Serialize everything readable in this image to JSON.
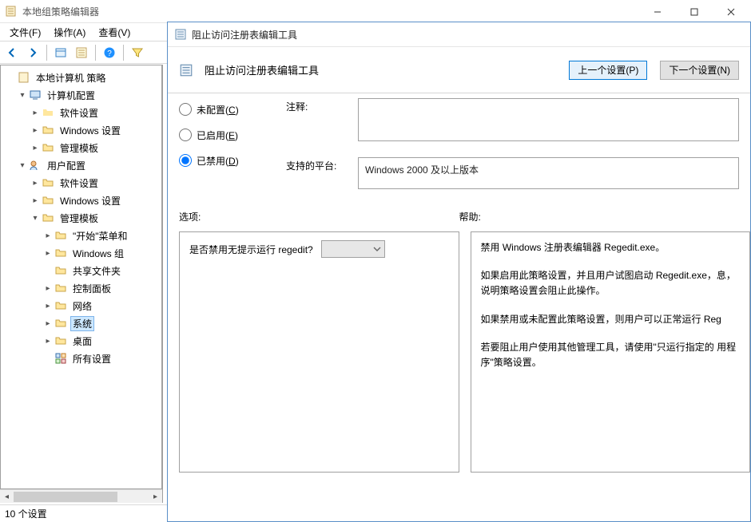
{
  "app": {
    "title": "本地组策略编辑器",
    "menubar": {
      "file": "文件(F)",
      "action": "操作(A)",
      "view": "查看(V)"
    },
    "statusbar": "10 个设置"
  },
  "tree": {
    "root": "本地计算机 策略",
    "computer_cfg": "计算机配置",
    "software1": "软件设置",
    "windows1": "Windows 设置",
    "admin_tmpl1": "管理模板",
    "user_cfg": "用户配置",
    "software2": "软件设置",
    "windows2": "Windows 设置",
    "admin_tmpl2": "管理模板",
    "start_menu": "\"开始\"菜单和",
    "windows_comp": "Windows 组",
    "shared_folders": "共享文件夹",
    "control_panel": "控制面板",
    "network": "网络",
    "system": "系统",
    "desktop": "桌面",
    "all_settings": "所有设置"
  },
  "dialog": {
    "title": "阻止访问注册表编辑工具",
    "header_title": "阻止访问注册表编辑工具",
    "prev": "上一个设置(P)",
    "next": "下一个设置(N)",
    "radio_not_configured": "未配置",
    "radio_not_configured_u": "C",
    "radio_enabled": "已启用",
    "radio_enabled_u": "E",
    "radio_disabled": "已禁用",
    "radio_disabled_u": "D",
    "comment_label": "注释:",
    "supported_label": "支持的平台:",
    "supported_value": "Windows 2000 及以上版本",
    "options_label": "选项:",
    "help_label": "帮助:",
    "option_question": "是否禁用无提示运行 regedit?",
    "help_p1": "禁用 Windows 注册表编辑器 Regedit.exe。",
    "help_p2": "如果启用此策略设置，并且用户试图启动 Regedit.exe，息，说明策略设置会阻止此操作。",
    "help_p3": "如果禁用或未配置此策略设置，则用户可以正常运行 Reg",
    "help_p4": "若要阻止用户使用其他管理工具，请使用\"只运行指定的 用程序\"策略设置。"
  }
}
